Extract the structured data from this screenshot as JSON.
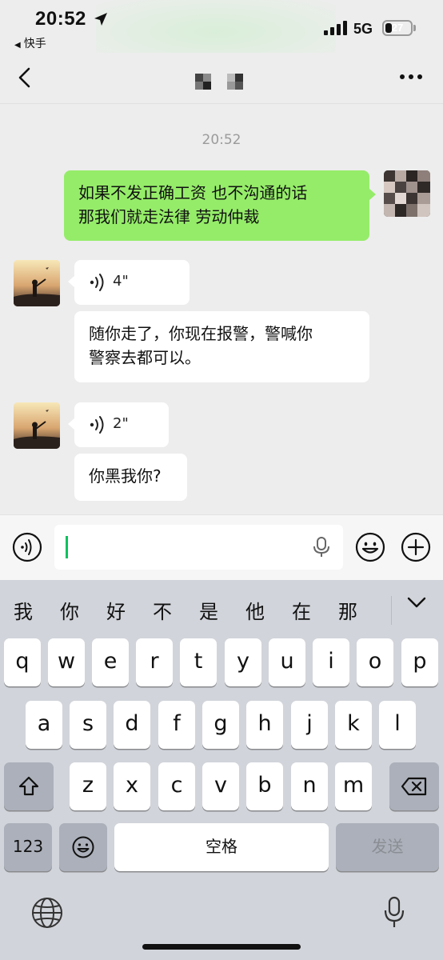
{
  "status_bar": {
    "time": "20:52",
    "back_app": "快手",
    "network": "5G",
    "battery": "27",
    "battery_level": 0.27
  },
  "nav": {
    "back_icon": "chevron-left-icon",
    "more_icon": "ellipsis-icon"
  },
  "chat": {
    "timestamp": "20:52",
    "messages": [
      {
        "sender": "me",
        "type": "text",
        "text_lines": [
          "如果不发正确工资 也不沟通的话",
          "那我们就走法律 劳动仲裁"
        ]
      },
      {
        "sender": "other",
        "type": "voice",
        "duration": "4\""
      },
      {
        "sender": "other",
        "type": "text",
        "text_lines": [
          "随你走了，你现在报警，警喊你",
          "警察去都可以。"
        ]
      },
      {
        "sender": "other",
        "type": "voice",
        "duration": "2\""
      },
      {
        "sender": "other",
        "type": "text",
        "text_lines": [
          "你黑我你?"
        ]
      }
    ]
  },
  "input_bar": {
    "value": "",
    "voice_toggle_icon": "voice-mode-icon",
    "emoji_icon": "emoji-icon",
    "plus_icon": "plus-icon"
  },
  "keyboard": {
    "candidates": [
      "我",
      "你",
      "好",
      "不",
      "是",
      "他",
      "在",
      "那"
    ],
    "row1": [
      "q",
      "w",
      "e",
      "r",
      "t",
      "y",
      "u",
      "i",
      "o",
      "p"
    ],
    "row2": [
      "a",
      "s",
      "d",
      "f",
      "g",
      "h",
      "j",
      "k",
      "l"
    ],
    "row3": [
      "z",
      "x",
      "c",
      "v",
      "b",
      "n",
      "m"
    ],
    "numbers_key": "123",
    "space_key": "空格",
    "send_key": "发送",
    "colors": {
      "send_bubble": "#95ec69",
      "caret": "#07c160"
    }
  }
}
